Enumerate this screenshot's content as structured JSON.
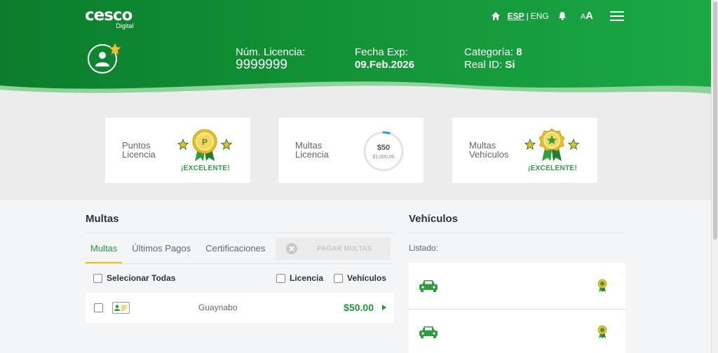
{
  "header": {
    "brand": "cesco",
    "brand_sub": "Digital",
    "lang_es": "ESP",
    "lang_sep": "|",
    "lang_en": "ENG",
    "font_small": "A",
    "font_large": "A",
    "license_label": "Núm. Licencia:",
    "license_value": "9999999",
    "exp_label": "Fecha Exp:",
    "exp_value": "09.Feb.2026",
    "category_label": "Categoría:",
    "category_value": "8",
    "realid_label": "Real ID:",
    "realid_value": "Si"
  },
  "cards": {
    "points": {
      "line1": "Puntos",
      "line2": "Licencia",
      "status": "¡EXCELENTE!",
      "icon": "p-medal-icon"
    },
    "license_fines": {
      "line1": "Multas",
      "line2": "Licencia",
      "amount": "$50",
      "max": "$1,000.00",
      "fraction": 0.05
    },
    "vehicle_fines": {
      "line1": "Multas",
      "line2": "Vehículos",
      "status": "¡EXCELENTE!",
      "icon": "star-medal-icon"
    }
  },
  "fines": {
    "title": "Multas",
    "tabs": [
      "Multas",
      "Últimos Pagos",
      "Certificaciones"
    ],
    "pay_button": "PAGAR MULTAS",
    "select_all": "Selecionar Todas",
    "filter_license": "Licencia",
    "filter_vehicles": "Vehículos",
    "rows": [
      {
        "city": "Guaynabo",
        "amount": "$50.00"
      }
    ]
  },
  "vehicles": {
    "title": "Vehículos",
    "list_label": "Listado:"
  },
  "colors": {
    "green_dark": "#0b7d2c",
    "green_light": "#1aa845",
    "accent_green": "#22973a",
    "gold": "#e8c020"
  }
}
